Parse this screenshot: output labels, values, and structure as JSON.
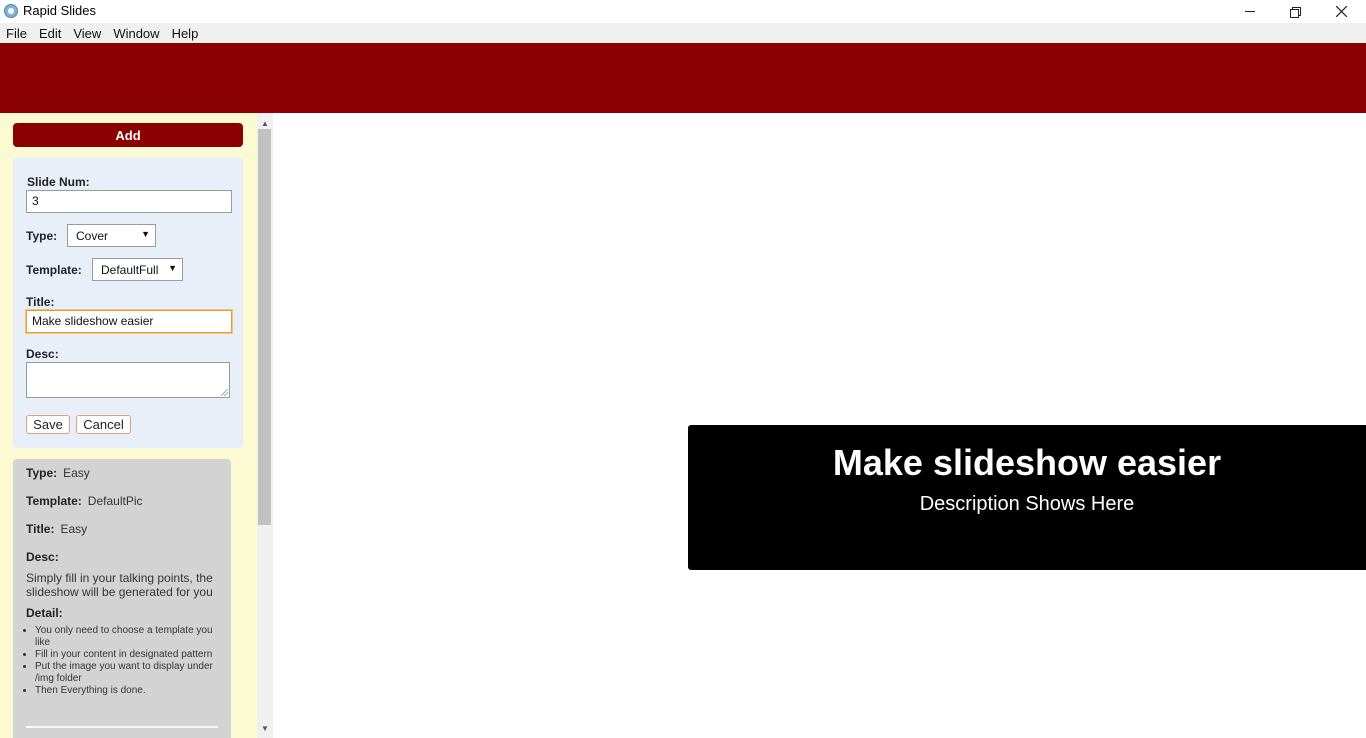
{
  "window": {
    "title": "Rapid Slides",
    "controls": {
      "minimize": "minimize-icon",
      "maximize": "restore-icon",
      "close": "close-icon"
    }
  },
  "menu": [
    "File",
    "Edit",
    "View",
    "Window",
    "Help"
  ],
  "colors": {
    "header": "#8b0000",
    "sidebar": "#fbfad2",
    "form_panel": "#e9eff8",
    "info_panel": "#d3d3d3",
    "slide_bg": "#000000"
  },
  "sidebar": {
    "add_label": "Add",
    "form": {
      "slide_num_label": "Slide Num:",
      "slide_num_value": "3",
      "type_label": "Type:",
      "type_value": "Cover",
      "template_label": "Template:",
      "template_value": "DefaultFull",
      "title_label": "Title:",
      "title_value": "Make slideshow easier",
      "desc_label": "Desc:",
      "desc_value": "",
      "save_label": "Save",
      "cancel_label": "Cancel"
    },
    "info": {
      "type_label": "Type:",
      "type_value": "Easy",
      "template_label": "Template:",
      "template_value": "DefaultPic",
      "title_label": "Title:",
      "title_value": "Easy",
      "desc_label": "Desc:",
      "desc_value": "Simply fill in your talking points, the slideshow will be generated for you",
      "detail_label": "Detail:",
      "details": [
        "You only need to choose a template you like",
        "Fill in your content in designated pattern",
        "Put the image you want to display under /img folder",
        "Then Everything is done."
      ]
    }
  },
  "preview": {
    "title": "Make slideshow easier",
    "desc": "Description Shows Here"
  }
}
